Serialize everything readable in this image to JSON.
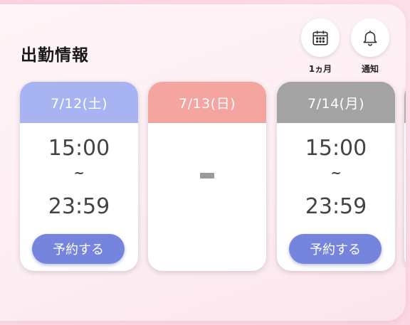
{
  "section": {
    "title": "出勤情報"
  },
  "buttons": {
    "month_label": "1ヵ月",
    "notify_label": "通知"
  },
  "days": [
    {
      "date": "7/12(土)",
      "start": "15:00",
      "separator": "~",
      "end": "23:59",
      "reserve_label": "予約する",
      "header_color": "#a8b4f2"
    },
    {
      "date": "7/13(日)",
      "empty_mark": "−",
      "header_color": "#f5a59f"
    },
    {
      "date": "7/14(月)",
      "start": "15:00",
      "separator": "~",
      "end": "23:59",
      "reserve_label": "予約する",
      "header_color": "#a3a3a3"
    }
  ],
  "colors": {
    "reserve_button": "#7585de",
    "background_pink": "#fbd6e2"
  },
  "icons": {
    "month": "calendar-icon",
    "notify": "bell-icon"
  }
}
